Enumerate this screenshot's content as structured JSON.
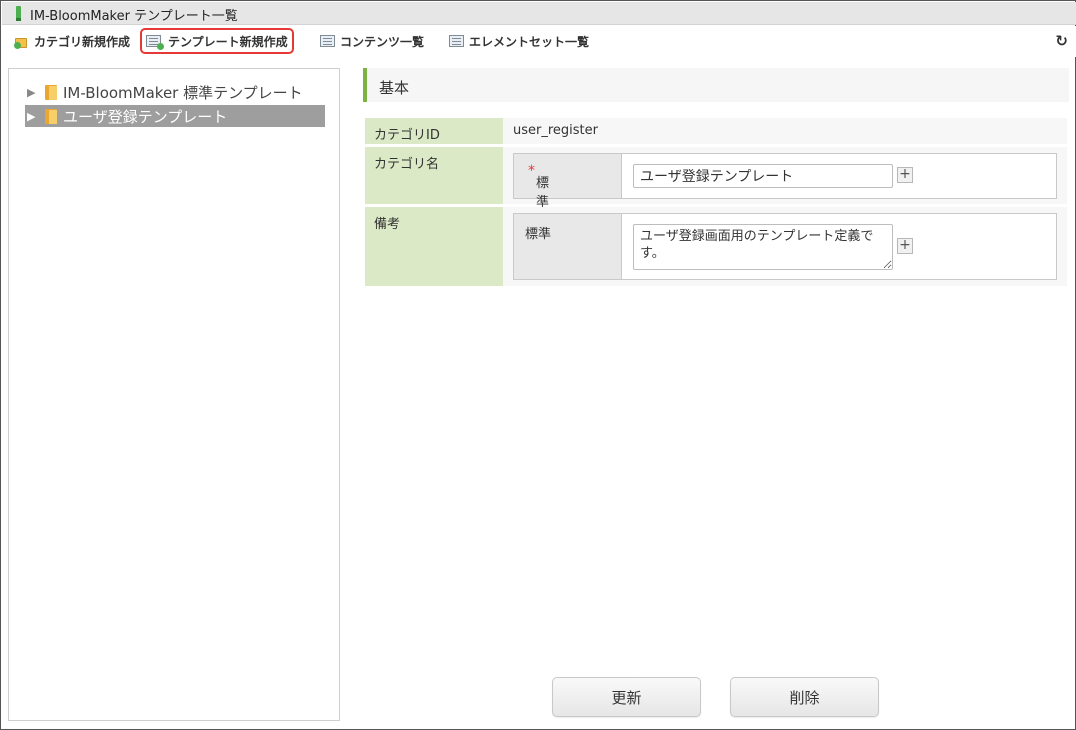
{
  "window": {
    "title": "IM-BloomMaker テンプレート一覧"
  },
  "toolbar": {
    "new_category": "カテゴリ新規作成",
    "new_template": "テンプレート新規作成",
    "contents_list": "コンテンツ一覧",
    "elementset_list": "エレメントセット一覧",
    "refresh_icon": "refresh-icon"
  },
  "tree": {
    "items": [
      {
        "label": "IM-BloomMaker 標準テンプレート",
        "selected": false
      },
      {
        "label": "ユーザ登録テンプレート",
        "selected": true
      }
    ]
  },
  "section": {
    "title": "基本"
  },
  "form": {
    "category_id": {
      "label": "カテゴリID",
      "value": "user_register"
    },
    "category_name": {
      "label": "カテゴリ名",
      "locale_label": "標準",
      "required_mark": "*",
      "value": "ユーザ登録テンプレート"
    },
    "remarks": {
      "label": "備考",
      "locale_label": "標準",
      "value": "ユーザ登録画面用のテンプレート定義です。"
    },
    "add_locale_symbol": "+"
  },
  "buttons": {
    "update": "更新",
    "delete": "削除"
  },
  "colors": {
    "highlight": "#e53935",
    "label_bg": "#dbe9c6",
    "accent": "#7cb342",
    "selected": "#9e9e9e"
  }
}
